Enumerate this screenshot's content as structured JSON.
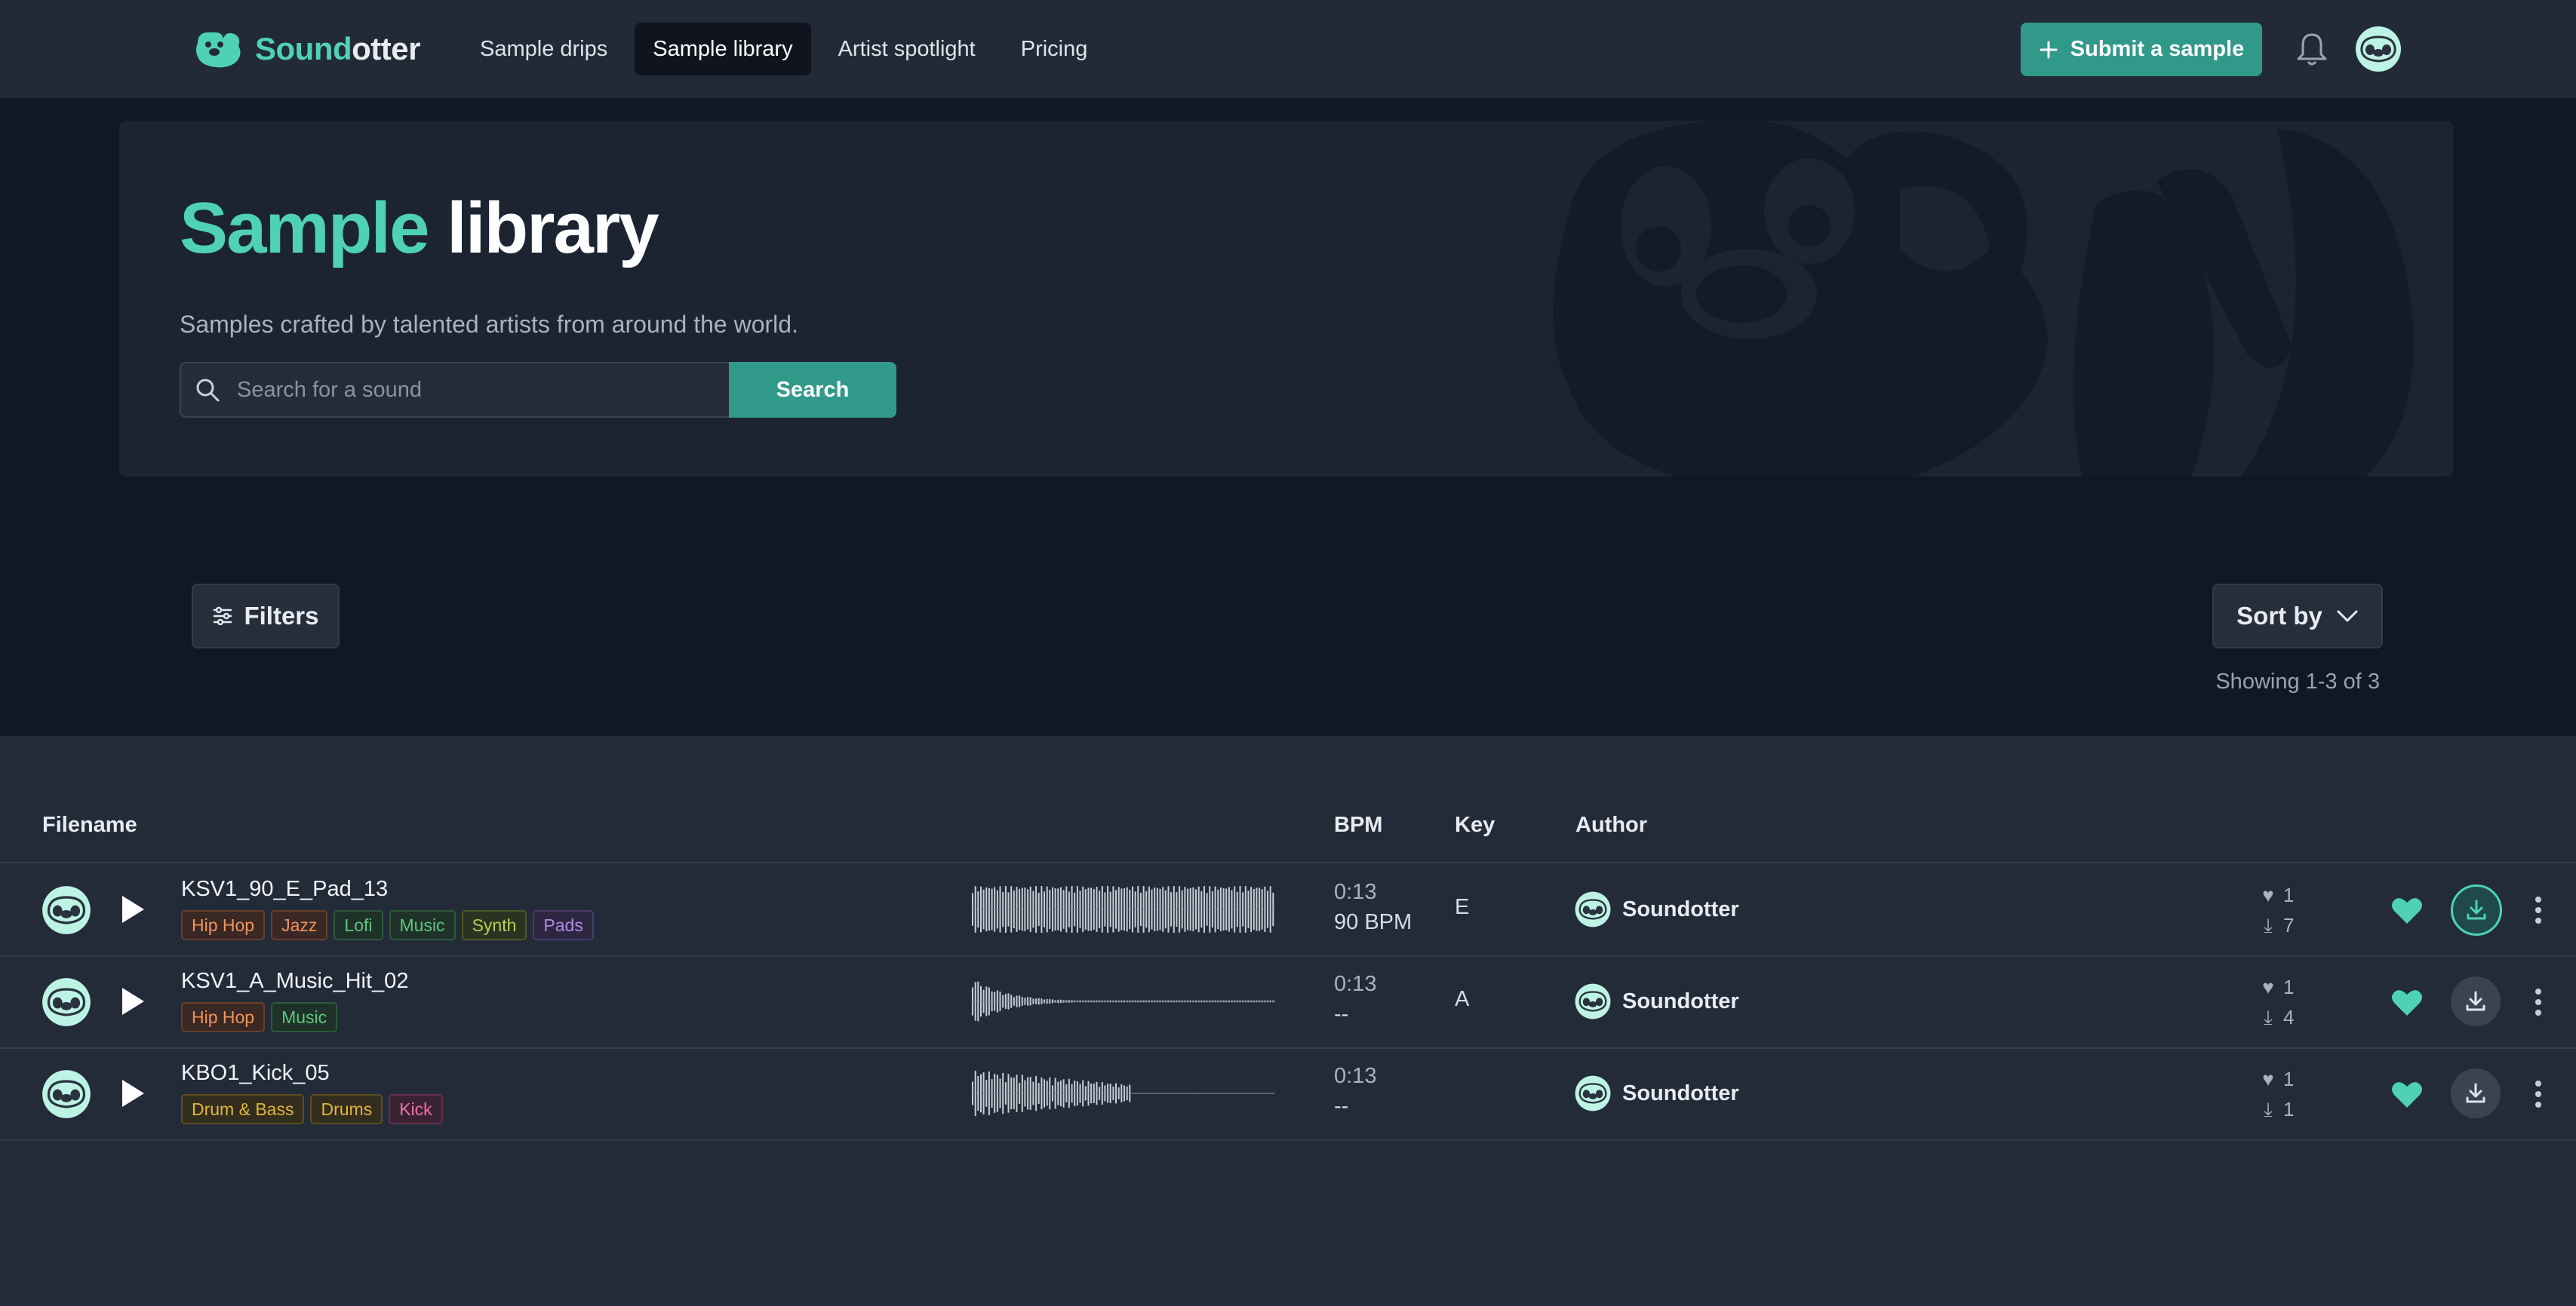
{
  "header": {
    "brand": {
      "part1": "Sound",
      "part2": "otter",
      "icon": "otter-logo-icon"
    },
    "nav": [
      "Sample drips",
      "Sample library",
      "Artist spotlight",
      "Pricing"
    ],
    "active_nav": "Sample library",
    "submit_label": "Submit a sample"
  },
  "hero": {
    "title_part1": "Sample",
    "title_part2": "library",
    "subtitle": "Samples crafted by talented artists from around the world.",
    "search_placeholder": "Search for a sound",
    "search_button": "Search"
  },
  "toolbar": {
    "filters_label": "Filters",
    "sort_label": "Sort by",
    "showing": "Showing 1-3 of 3"
  },
  "table": {
    "headers": {
      "filename": "Filename",
      "bpm": "BPM",
      "key": "Key",
      "author": "Author"
    },
    "rows": [
      {
        "filename": "KSV1_90_E_Pad_13",
        "tags": [
          {
            "label": "Hip Hop",
            "color": "orange"
          },
          {
            "label": "Jazz",
            "color": "orange"
          },
          {
            "label": "Lofi",
            "color": "green"
          },
          {
            "label": "Music",
            "color": "green"
          },
          {
            "label": "Synth",
            "color": "lime"
          },
          {
            "label": "Pads",
            "color": "purple"
          }
        ],
        "duration": "0:13",
        "bpm": "90 BPM",
        "key": "E",
        "author": "Soundotter",
        "likes": "1",
        "downloads": "7",
        "download_active": true
      },
      {
        "filename": "KSV1_A_Music_Hit_02",
        "tags": [
          {
            "label": "Hip Hop",
            "color": "orange"
          },
          {
            "label": "Music",
            "color": "green"
          }
        ],
        "duration": "0:13",
        "bpm": "--",
        "key": "A",
        "author": "Soundotter",
        "likes": "1",
        "downloads": "4",
        "download_active": false
      },
      {
        "filename": "KBO1_Kick_05",
        "tags": [
          {
            "label": "Drum & Bass",
            "color": "yellow"
          },
          {
            "label": "Drums",
            "color": "yellow"
          },
          {
            "label": "Kick",
            "color": "pink"
          }
        ],
        "duration": "0:13",
        "bpm": "--",
        "key": "",
        "author": "Soundotter",
        "likes": "1",
        "downloads": "1",
        "download_active": false
      }
    ]
  },
  "colors": {
    "accent": "#4fd1b8",
    "button": "#31998a",
    "background": "#232b39",
    "hero_bg": "#111725"
  }
}
